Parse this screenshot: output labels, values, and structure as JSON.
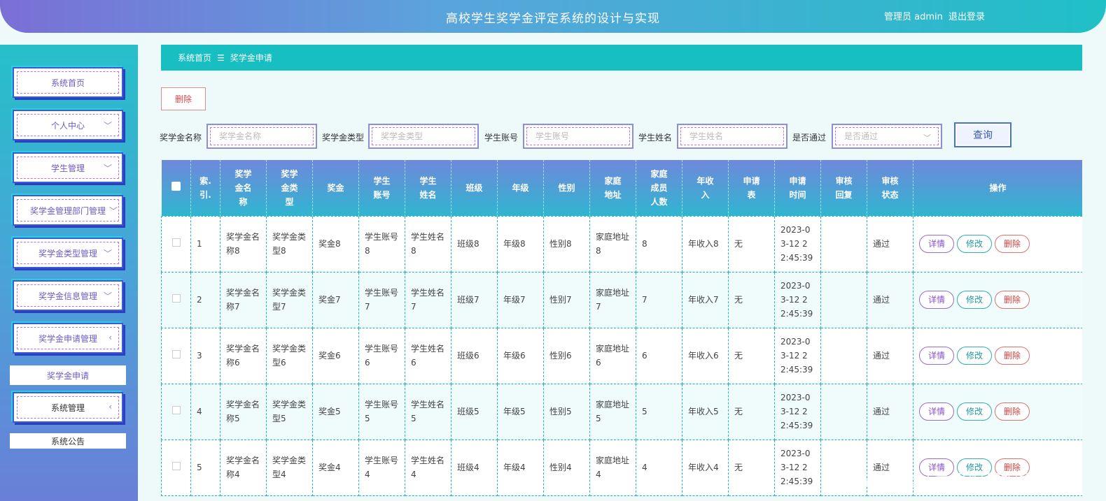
{
  "header": {
    "title": "高校学生奖学金评定系统的设计与实现",
    "user": "管理员 admin",
    "logout": "退出登录"
  },
  "sidebar": {
    "items": [
      {
        "label": "系统首页",
        "chev": ""
      },
      {
        "label": "个人中心",
        "chev": "﹀"
      },
      {
        "label": "学生管理",
        "chev": "﹀"
      },
      {
        "label": "奖学金管理部门管理",
        "chev": "﹀"
      },
      {
        "label": "奖学金类型管理",
        "chev": "﹀"
      },
      {
        "label": "奖学金信息管理",
        "chev": "﹀"
      },
      {
        "label": "奖学金申请管理",
        "chev": "‹"
      },
      {
        "label": "系统管理",
        "chev": "‹"
      }
    ],
    "sub_apply": "奖学金申请",
    "sub_notice": "系统公告"
  },
  "breadcrumb": {
    "home": "系统首页",
    "sep": "☰",
    "current": "奖学金申请"
  },
  "toolbar": {
    "delete_label": "删除"
  },
  "search": {
    "name_label": "奖学金名称",
    "name_placeholder": "奖学金名称",
    "type_label": "奖学金类型",
    "type_placeholder": "奖学金类型",
    "account_label": "学生账号",
    "account_placeholder": "学生账号",
    "student_label": "学生姓名",
    "student_placeholder": "学生姓名",
    "pass_label": "是否通过",
    "pass_placeholder": "是否通过",
    "query_label": "查询"
  },
  "table": {
    "headers": [
      "",
      "索引",
      "奖学金名称",
      "奖学金类型",
      "奖金",
      "学生账号",
      "学生姓名",
      "班级",
      "年级",
      "性别",
      "家庭地址",
      "家庭成员人数",
      "年收入",
      "申请表",
      "申请时间",
      "审核回复",
      "审核状态",
      "操作"
    ],
    "header_display": [
      "",
      "索.\n引.",
      "奖学\n金名\n称",
      "奖学\n金类\n型",
      "奖金",
      "学生\n账号",
      "学生\n姓名",
      "班级",
      "年级",
      "性别",
      "家庭\n地址",
      "家庭\n成员\n人数",
      "年收\n入",
      "申请\n表",
      "申请\n时间",
      "审核\n回复",
      "审核\n状态",
      "操作"
    ],
    "rows": [
      {
        "index": "1",
        "name": "奖学金名称8",
        "type": "奖学金类型8",
        "bonus": "奖金8",
        "account": "学生账号8",
        "student": "学生姓名8",
        "cls": "班级8",
        "grade": "年级8",
        "gender": "性别8",
        "address": "家庭地址8",
        "members": "8",
        "income": "年收入8",
        "form": "无",
        "time": "2023-03-12 22:45:39",
        "reply": "",
        "status": "通过"
      },
      {
        "index": "2",
        "name": "奖学金名称7",
        "type": "奖学金类型7",
        "bonus": "奖金7",
        "account": "学生账号7",
        "student": "学生姓名7",
        "cls": "班级7",
        "grade": "年级7",
        "gender": "性别7",
        "address": "家庭地址7",
        "members": "7",
        "income": "年收入7",
        "form": "无",
        "time": "2023-03-12 22:45:39",
        "reply": "",
        "status": "通过"
      },
      {
        "index": "3",
        "name": "奖学金名称6",
        "type": "奖学金类型6",
        "bonus": "奖金6",
        "account": "学生账号6",
        "student": "学生姓名6",
        "cls": "班级6",
        "grade": "年级6",
        "gender": "性别6",
        "address": "家庭地址6",
        "members": "6",
        "income": "年收入6",
        "form": "无",
        "time": "2023-03-12 22:45:39",
        "reply": "",
        "status": "通过"
      },
      {
        "index": "4",
        "name": "奖学金名称5",
        "type": "奖学金类型5",
        "bonus": "奖金5",
        "account": "学生账号5",
        "student": "学生姓名5",
        "cls": "班级5",
        "grade": "年级5",
        "gender": "性别5",
        "address": "家庭地址5",
        "members": "5",
        "income": "年收入5",
        "form": "无",
        "time": "2023-03-12 22:45:39",
        "reply": "",
        "status": "通过"
      },
      {
        "index": "5",
        "name": "奖学金名称4",
        "type": "奖学金类型4",
        "bonus": "奖金4",
        "account": "学生账号4",
        "student": "学生姓名4",
        "cls": "班级4",
        "grade": "年级4",
        "gender": "性别4",
        "address": "家庭地址4",
        "members": "4",
        "income": "年收入4",
        "form": "无",
        "time": "2023-03-12 22:45:39",
        "reply": "",
        "status": "通过"
      }
    ],
    "actions": {
      "detail": "详情",
      "edit": "修改",
      "delete": "删除"
    }
  },
  "watermark": "CSDN @计算机编程指导师"
}
